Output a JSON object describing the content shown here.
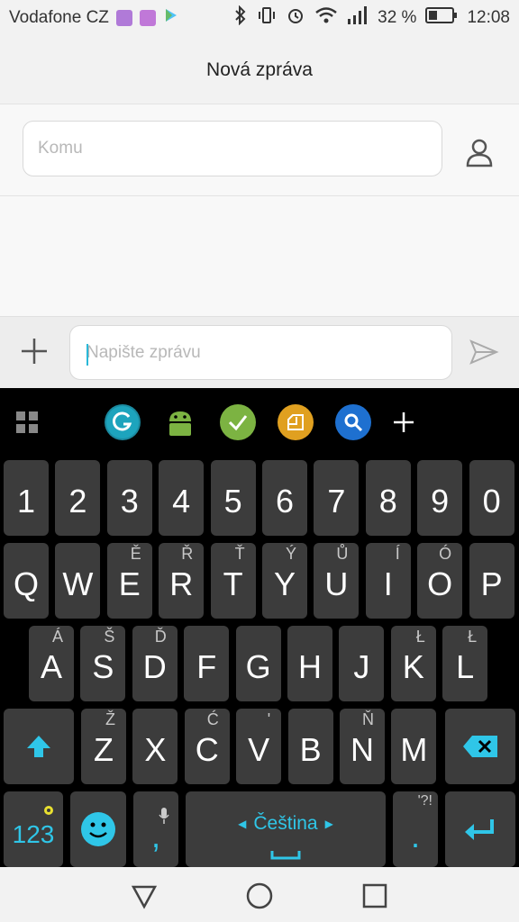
{
  "status": {
    "carrier": "Vodafone CZ",
    "battery": "32 %",
    "time": "12:08"
  },
  "header": {
    "title": "Nová zpráva"
  },
  "recipient": {
    "placeholder": "Komu"
  },
  "composer": {
    "placeholder": "Napište zprávu"
  },
  "keyboard": {
    "number_row": [
      "1",
      "2",
      "3",
      "4",
      "5",
      "6",
      "7",
      "8",
      "9",
      "0"
    ],
    "row1": [
      {
        "k": "Q",
        "a": ""
      },
      {
        "k": "W",
        "a": ""
      },
      {
        "k": "E",
        "a": "Ě"
      },
      {
        "k": "R",
        "a": "Ř"
      },
      {
        "k": "T",
        "a": "Ť"
      },
      {
        "k": "Y",
        "a": "Ý"
      },
      {
        "k": "U",
        "a": "Ů"
      },
      {
        "k": "I",
        "a": "Í"
      },
      {
        "k": "O",
        "a": "Ó"
      },
      {
        "k": "P",
        "a": ""
      }
    ],
    "row2": [
      {
        "k": "A",
        "a": "Á"
      },
      {
        "k": "S",
        "a": "Š"
      },
      {
        "k": "D",
        "a": "Ď"
      },
      {
        "k": "F",
        "a": ""
      },
      {
        "k": "G",
        "a": ""
      },
      {
        "k": "H",
        "a": ""
      },
      {
        "k": "J",
        "a": ""
      },
      {
        "k": "K",
        "a": "Ł"
      },
      {
        "k": "L",
        "a": "Ł"
      }
    ],
    "row3": [
      {
        "k": "Z",
        "a": "Ž"
      },
      {
        "k": "X",
        "a": ""
      },
      {
        "k": "C",
        "a": "Ć"
      },
      {
        "k": "V",
        "a": "'"
      },
      {
        "k": "B",
        "a": ""
      },
      {
        "k": "N",
        "a": "Ň"
      },
      {
        "k": "M",
        "a": ""
      }
    ],
    "symbols_label": "123",
    "comma": ",",
    "space_label": "Čeština",
    "period": ".",
    "period_alt": "'?!"
  },
  "colors": {
    "accent": "#2fc6e8",
    "key_bg": "#3c3c3c",
    "keyboard_bg": "#000000"
  }
}
